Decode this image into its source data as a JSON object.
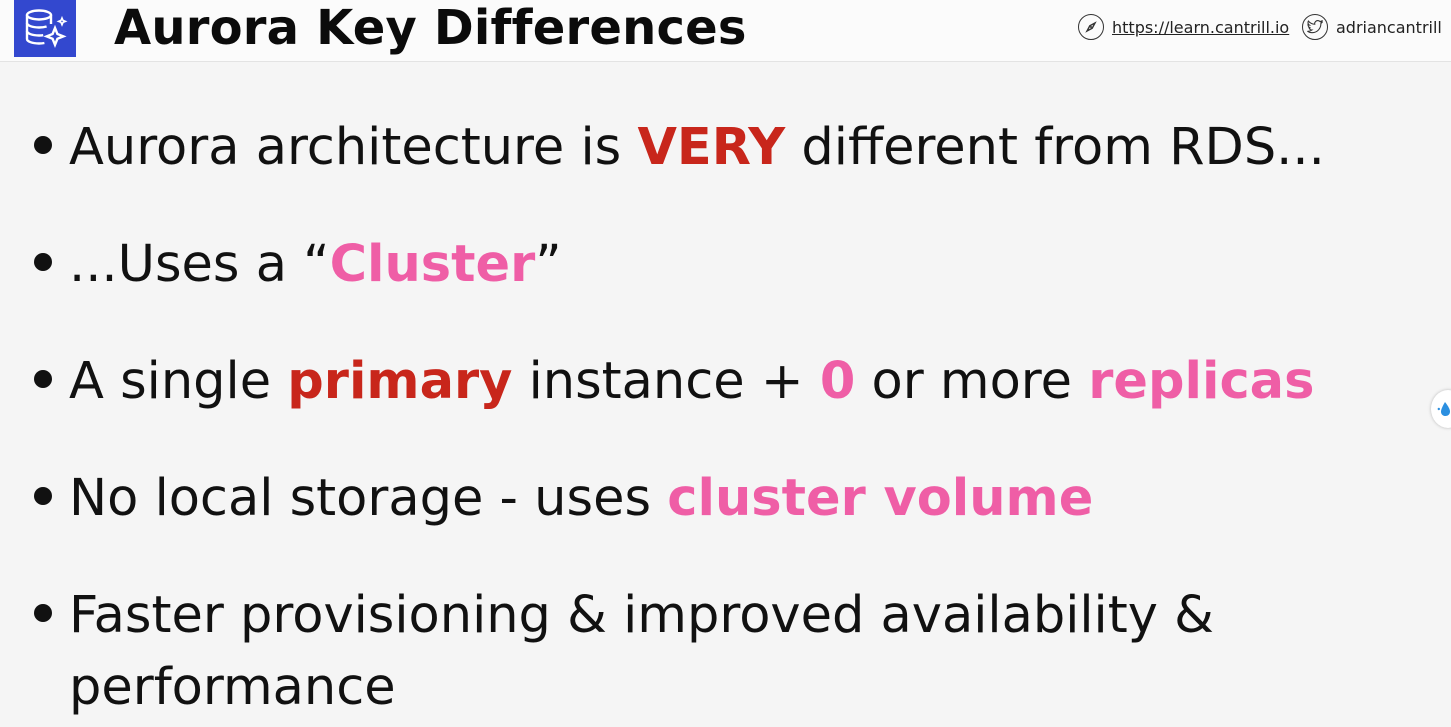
{
  "header": {
    "title": "Aurora Key Differences",
    "logo_icon": "database-sparkle-icon",
    "link_text": "https://learn.cantrill.io",
    "link_icon": "compass-icon",
    "handle_text": "adriancantrill",
    "handle_icon": "twitter-icon"
  },
  "colors": {
    "accent_red": "#c8261b",
    "accent_pink": "#ef5ea6",
    "logo_blue": "#3348cf"
  },
  "bullets": [
    {
      "parts": [
        "Aurora architecture is ",
        "VERY",
        " different from RDS..."
      ]
    },
    {
      "parts": [
        "...Uses a “",
        "Cluster",
        "”"
      ]
    },
    {
      "parts": [
        "A single ",
        "primary",
        " instance + ",
        "0",
        " or more ",
        "replicas"
      ]
    },
    {
      "parts": [
        "No local storage - uses ",
        "cluster volume"
      ]
    },
    {
      "parts": [
        "Faster provisioning & improved availability & performance"
      ]
    }
  ]
}
